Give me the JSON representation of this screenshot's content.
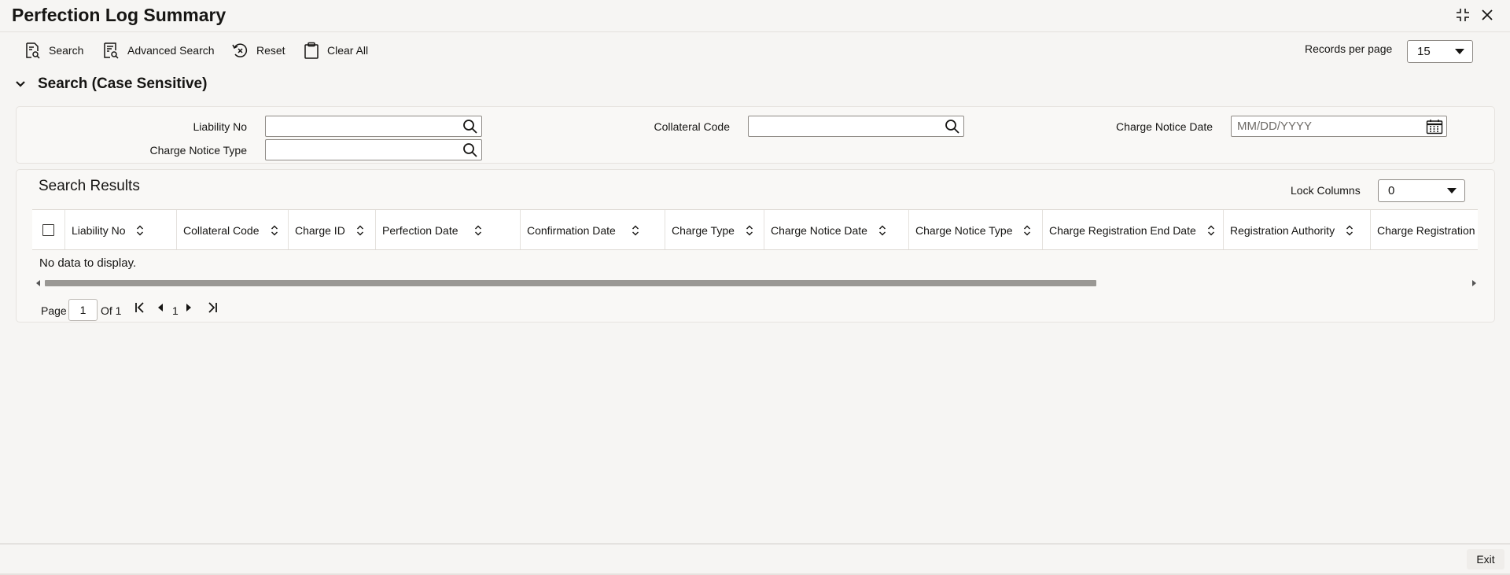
{
  "page": {
    "title": "Perfection Log Summary"
  },
  "window": {
    "maximize_icon": "expand-icon",
    "close_icon": "close-icon"
  },
  "toolbar": {
    "search_label": "Search",
    "advanced_search_label": "Advanced Search",
    "reset_label": "Reset",
    "clear_all_label": "Clear All",
    "records_per_page_label": "Records per page",
    "records_per_page_value": "15"
  },
  "search_section": {
    "title": "Search (Case Sensitive)",
    "fields": {
      "liability_no": {
        "label": "Liability No",
        "value": ""
      },
      "collateral_code": {
        "label": "Collateral Code",
        "value": ""
      },
      "charge_notice_date": {
        "label": "Charge Notice Date",
        "placeholder": "MM/DD/YYYY"
      },
      "charge_notice_type": {
        "label": "Charge Notice Type",
        "value": ""
      }
    }
  },
  "results": {
    "title": "Search Results",
    "lock_columns_label": "Lock Columns",
    "lock_columns_value": "0",
    "columns": [
      "Liability No",
      "Collateral Code",
      "Charge ID",
      "Perfection Date",
      "Confirmation Date",
      "Charge Type",
      "Charge Notice Date",
      "Charge Notice Type",
      "Charge Registration End Date",
      "Registration Authority",
      "Charge Registration Nur"
    ],
    "empty_message": "No data to display."
  },
  "pagination": {
    "page_label": "Page",
    "current_page": "1",
    "of_label": "Of 1",
    "page_number": "1"
  },
  "footer": {
    "exit_label": "Exit"
  }
}
